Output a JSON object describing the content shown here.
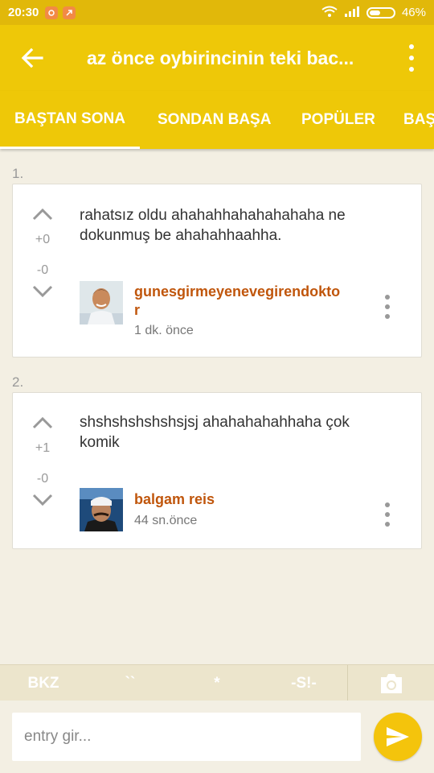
{
  "status_bar": {
    "time": "20:30",
    "battery": "46%"
  },
  "app_bar": {
    "title": "az önce oybirincinin teki bac..."
  },
  "tabs": [
    {
      "label": "BAŞTAN SONA",
      "active": true
    },
    {
      "label": "SONDAN BAŞA",
      "active": false
    },
    {
      "label": "POPÜLER",
      "active": false
    },
    {
      "label": "BAŞ",
      "active": false
    }
  ],
  "entries": [
    {
      "number": "1.",
      "upvotes": "+0",
      "downvotes": "-0",
      "text": "rahatsız oldu ahahahhahahahahaha ne dokunmuş be ahahahhaahha.",
      "author": "gunesgirmeyenevegirendoktor",
      "time": "1 dk. önce"
    },
    {
      "number": "2.",
      "upvotes": "+1",
      "downvotes": "-0",
      "text": "shshshshshshsjsj ahahahahahhaha çok komik",
      "author": "balgam reis",
      "time": "44 sn.önce"
    }
  ],
  "format_bar": {
    "bkz": "BKZ",
    "backtick": "``",
    "asterisk": "*",
    "spoiler": "-S!-"
  },
  "input": {
    "placeholder": "entry gir..."
  },
  "colors": {
    "primary": "#eec808",
    "status": "#e1b80a",
    "author": "#c0560c",
    "background": "#f3efe3"
  }
}
